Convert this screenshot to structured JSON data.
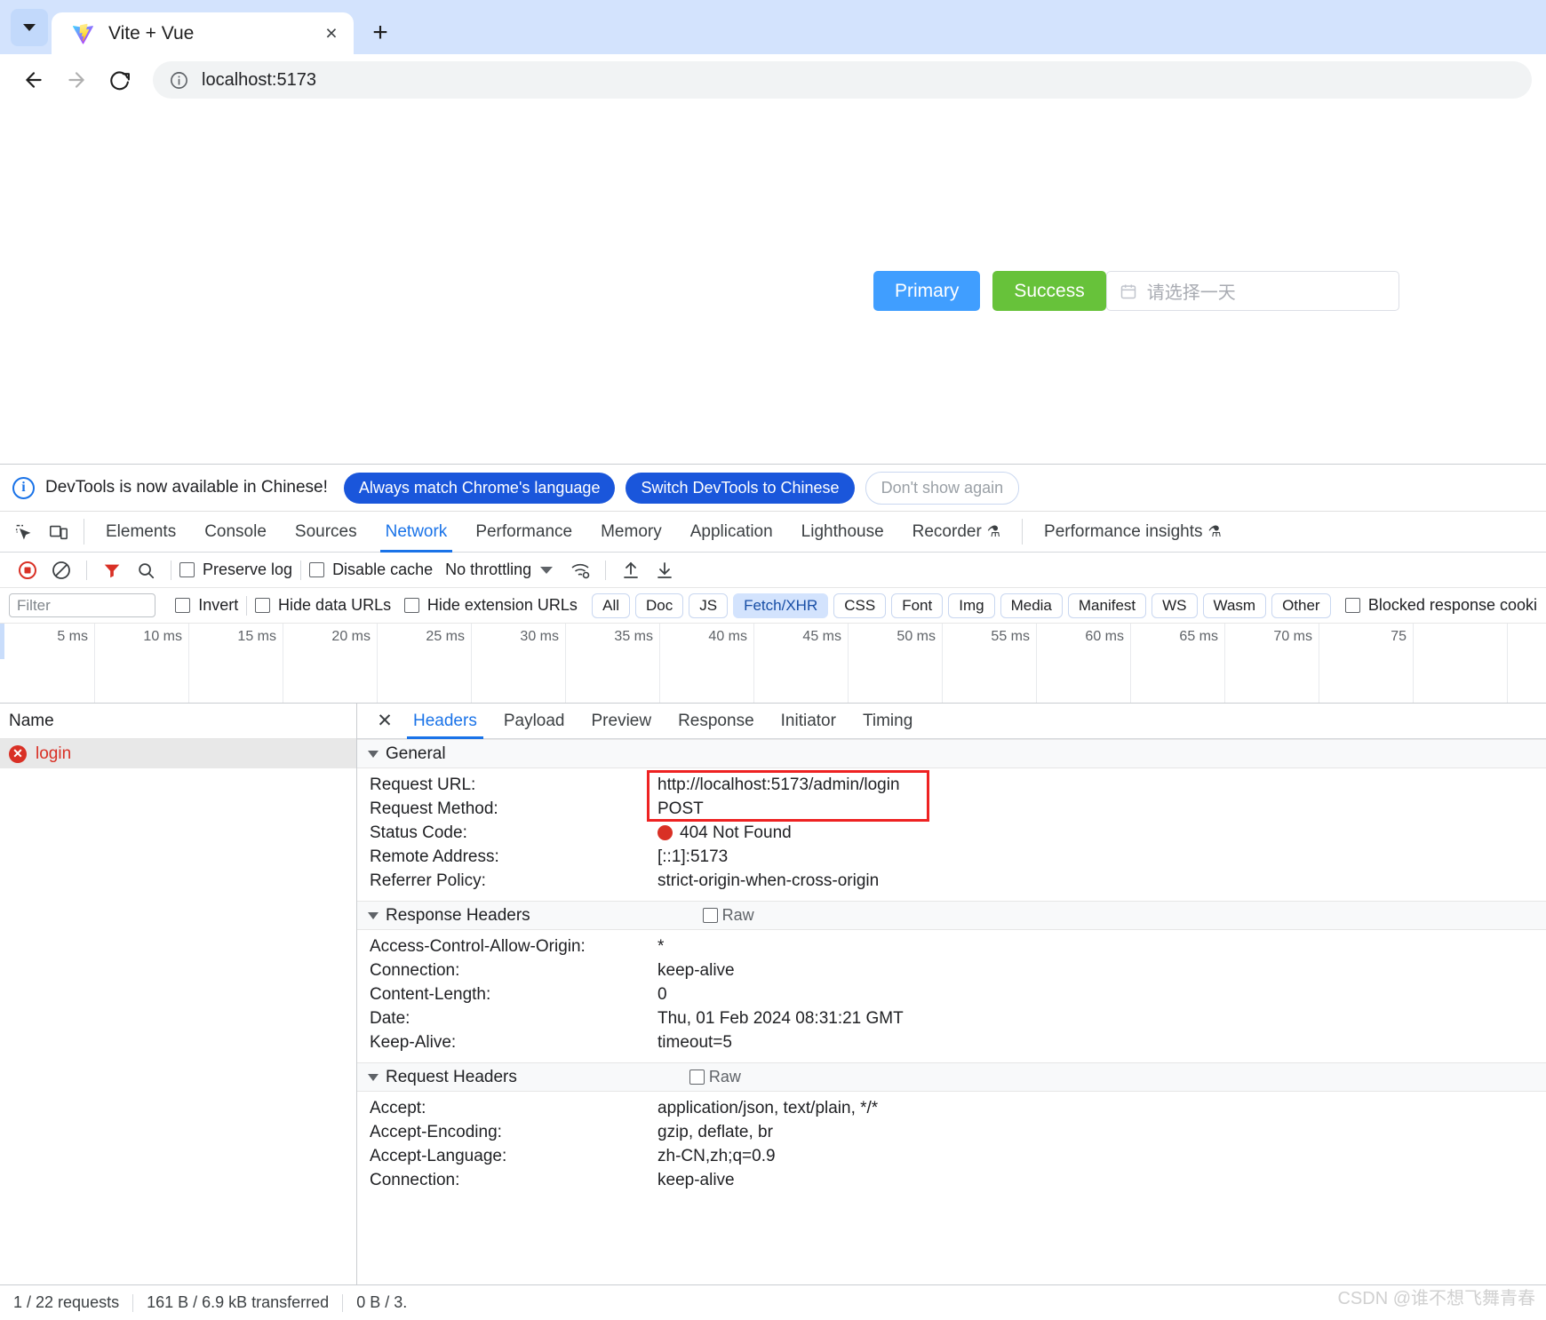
{
  "browser": {
    "tab": {
      "title": "Vite + Vue",
      "favicon": "vite-logo-icon",
      "close_label": "×"
    },
    "new_tab_label": "+",
    "tab_search_icon": "chevron-down-icon",
    "nav": {
      "back": "back-arrow-icon",
      "forward": "forward-arrow-icon",
      "reload": "reload-icon"
    },
    "omnibox": {
      "site_info_icon": "info-circle-icon",
      "url": "localhost:5173"
    }
  },
  "page": {
    "primary_button": "Primary",
    "success_button": "Success",
    "date_picker": {
      "icon": "calendar-icon",
      "placeholder": "请选择一天"
    },
    "colors": {
      "primary": "#409eff",
      "success": "#67c23a"
    }
  },
  "devtools": {
    "banner": {
      "icon": "info-icon",
      "text": "DevTools is now available in Chinese!",
      "btn_always": "Always match Chrome's language",
      "btn_switch": "Switch DevTools to Chinese",
      "btn_dismiss": "Don't show again"
    },
    "panel_tabs": [
      {
        "label": "Elements",
        "active": false,
        "flask": false
      },
      {
        "label": "Console",
        "active": false,
        "flask": false
      },
      {
        "label": "Sources",
        "active": false,
        "flask": false
      },
      {
        "label": "Network",
        "active": true,
        "flask": false
      },
      {
        "label": "Performance",
        "active": false,
        "flask": false
      },
      {
        "label": "Memory",
        "active": false,
        "flask": false
      },
      {
        "label": "Application",
        "active": false,
        "flask": false
      },
      {
        "label": "Lighthouse",
        "active": false,
        "flask": false
      },
      {
        "label": "Recorder",
        "active": false,
        "flask": true
      },
      {
        "label": "Performance insights",
        "active": false,
        "flask": true
      }
    ],
    "inspect_icon": "inspect-element-icon",
    "device_icon": "device-toolbar-icon",
    "network_toolbar": {
      "record_icon": "record-stop-icon",
      "clear_icon": "clear-network-log-icon",
      "filter_icon": "filter-icon",
      "search_icon": "search-icon",
      "preserve_log": "Preserve log",
      "disable_cache": "Disable cache",
      "throttling": "No throttling",
      "throttling_caret": "chevron-down-icon",
      "wifi_icon": "network-conditions-icon",
      "import_icon": "import-har-icon",
      "export_icon": "export-har-icon"
    },
    "filter_bar": {
      "filter_placeholder": "Filter",
      "invert": "Invert",
      "hide_data_urls": "Hide data URLs",
      "hide_extension_urls": "Hide extension URLs",
      "type_chips": [
        {
          "label": "All",
          "selected": false
        },
        {
          "label": "Doc",
          "selected": false
        },
        {
          "label": "JS",
          "selected": false
        },
        {
          "label": "Fetch/XHR",
          "selected": true
        },
        {
          "label": "CSS",
          "selected": false
        },
        {
          "label": "Font",
          "selected": false
        },
        {
          "label": "Img",
          "selected": false
        },
        {
          "label": "Media",
          "selected": false
        },
        {
          "label": "Manifest",
          "selected": false
        },
        {
          "label": "WS",
          "selected": false
        },
        {
          "label": "Wasm",
          "selected": false
        },
        {
          "label": "Other",
          "selected": false
        }
      ],
      "blocked_cookies": "Blocked response cooki"
    },
    "timeline_ticks": [
      "5 ms",
      "10 ms",
      "15 ms",
      "20 ms",
      "25 ms",
      "30 ms",
      "35 ms",
      "40 ms",
      "45 ms",
      "50 ms",
      "55 ms",
      "60 ms",
      "65 ms",
      "70 ms",
      "75"
    ],
    "request_list": {
      "column_name": "Name",
      "rows": [
        {
          "name": "login",
          "status_icon": "error-icon",
          "selected": true
        }
      ]
    },
    "detail_tabs": [
      {
        "label": "Headers",
        "active": true
      },
      {
        "label": "Payload",
        "active": false
      },
      {
        "label": "Preview",
        "active": false
      },
      {
        "label": "Response",
        "active": false
      },
      {
        "label": "Initiator",
        "active": false
      },
      {
        "label": "Timing",
        "active": false
      }
    ],
    "detail_close_icon": "close-icon",
    "sections": {
      "general": {
        "title": "General",
        "rows": [
          {
            "key": "Request URL:",
            "value": "http://localhost:5173/admin/login"
          },
          {
            "key": "Request Method:",
            "value": "POST"
          },
          {
            "key": "Status Code:",
            "value": "404 Not Found",
            "dot": true
          },
          {
            "key": "Remote Address:",
            "value": "[::1]:5173"
          },
          {
            "key": "Referrer Policy:",
            "value": "strict-origin-when-cross-origin"
          }
        ],
        "highlight_color": "#ee2222"
      },
      "response_headers": {
        "title": "Response Headers",
        "raw_label": "Raw",
        "rows": [
          {
            "key": "Access-Control-Allow-Origin:",
            "value": "*"
          },
          {
            "key": "Connection:",
            "value": "keep-alive"
          },
          {
            "key": "Content-Length:",
            "value": "0"
          },
          {
            "key": "Date:",
            "value": "Thu, 01 Feb 2024 08:31:21 GMT"
          },
          {
            "key": "Keep-Alive:",
            "value": "timeout=5"
          }
        ]
      },
      "request_headers": {
        "title": "Request Headers",
        "raw_label": "Raw",
        "rows": [
          {
            "key": "Accept:",
            "value": "application/json, text/plain, */*"
          },
          {
            "key": "Accept-Encoding:",
            "value": "gzip, deflate, br"
          },
          {
            "key": "Accept-Language:",
            "value": "zh-CN,zh;q=0.9"
          },
          {
            "key": "Connection:",
            "value": "keep-alive"
          }
        ]
      }
    },
    "status_bar": {
      "requests": "1 / 22 requests",
      "transferred": "161 B / 6.9 kB transferred",
      "resources": "0 B / 3."
    }
  },
  "watermark": "CSDN @谁不想飞舞青春"
}
